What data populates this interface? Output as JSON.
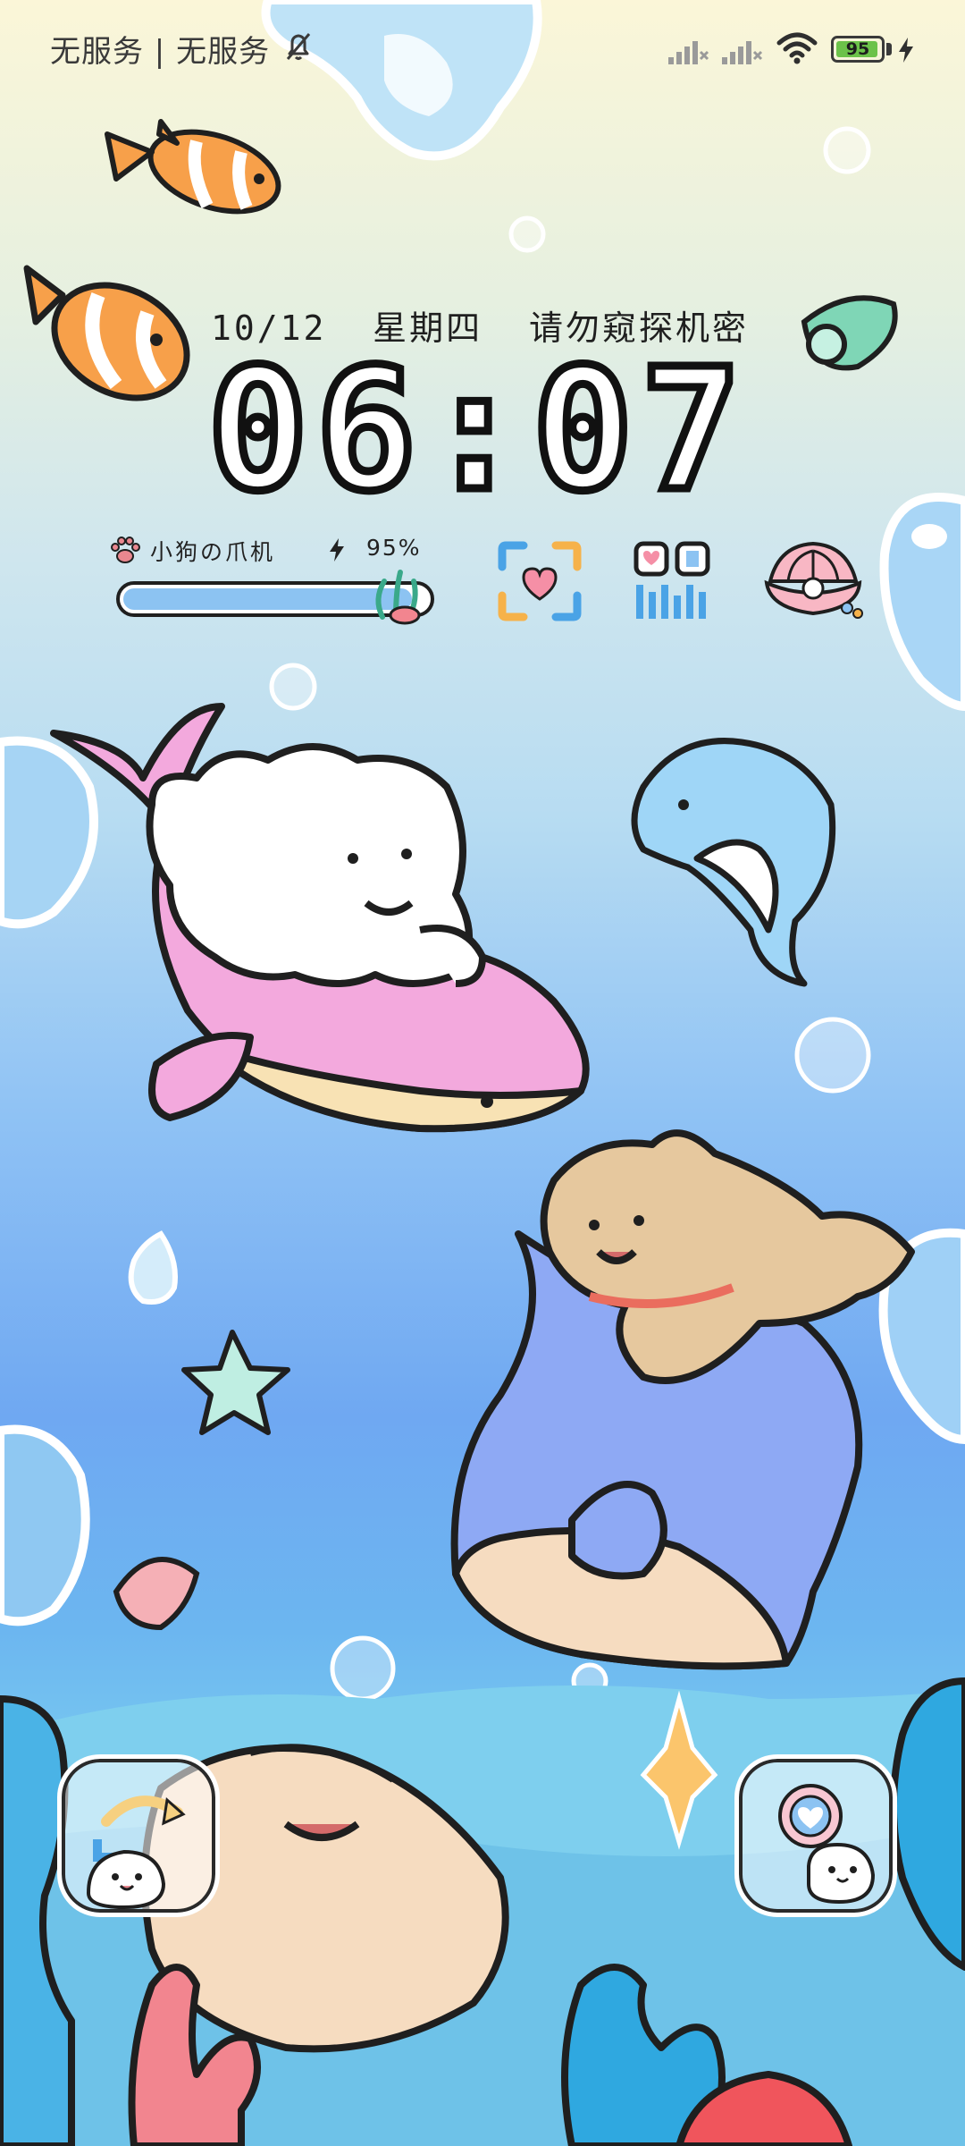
{
  "status_bar": {
    "carrier": "无服务 | 无服务",
    "battery_level": "95",
    "icons": [
      "mute-bell-icon",
      "signal-no-service-icon",
      "signal-no-service-icon",
      "wifi-icon",
      "battery-icon",
      "charging-bolt-icon"
    ]
  },
  "lockscreen": {
    "date": "10/12",
    "weekday": "星期四",
    "motto": "请勿窥探机密",
    "time": "06:07"
  },
  "battery_widget": {
    "title": "小狗の爪机",
    "percent": "95%",
    "level_fraction": 0.95
  },
  "quick_actions": [
    "scan-icon",
    "qr-code-icon",
    "shell-pearl-icon"
  ],
  "shortcuts": [
    "left-shortcut-button",
    "right-shortcut-button"
  ],
  "colors": {
    "accent_blue": "#8cc3f2",
    "battery_green": "#6cc24a",
    "outline": "#1f1f1f"
  }
}
